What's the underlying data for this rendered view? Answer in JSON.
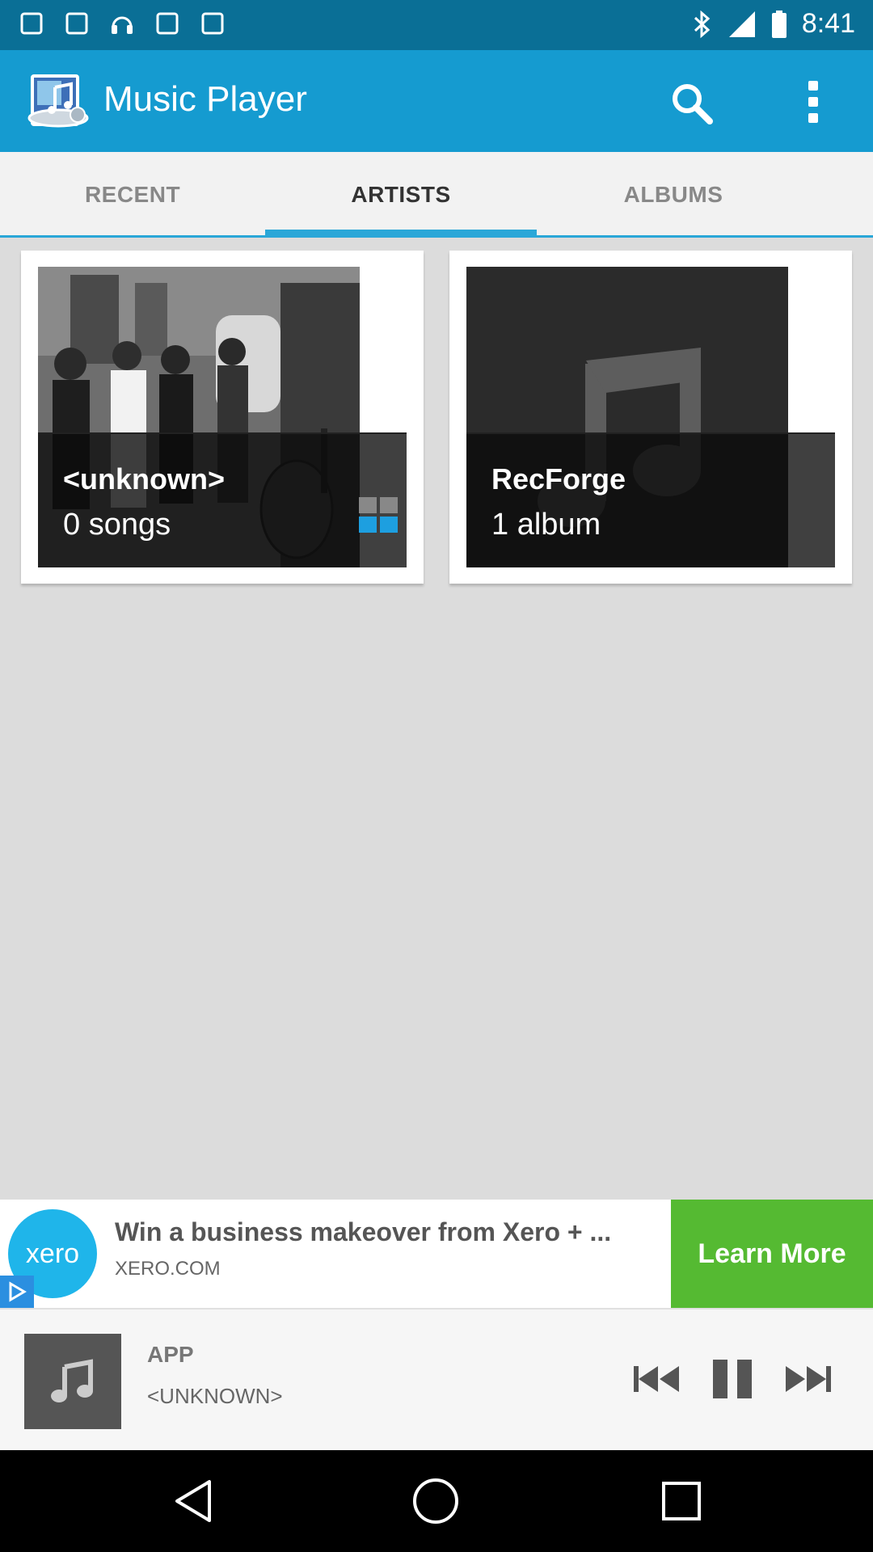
{
  "status_bar": {
    "time": "8:41"
  },
  "app_bar": {
    "title": "Music Player",
    "icons": [
      "app-logo-icon",
      "search-icon",
      "more-vert-icon"
    ]
  },
  "tabs": [
    {
      "label": "RECENT",
      "active": false
    },
    {
      "label": "ARTISTS",
      "active": true
    },
    {
      "label": "ALBUMS",
      "active": false
    }
  ],
  "artists": [
    {
      "name": "<unknown>",
      "subtitle": "0 songs"
    },
    {
      "name": "RecForge",
      "subtitle": "1 album"
    }
  ],
  "ad": {
    "logo_text": "xero",
    "title": "Win a business makeover from Xero + ...",
    "domain": "XERO.COM",
    "cta": "Learn More"
  },
  "now_playing": {
    "title": "APP",
    "artist": "<UNKNOWN>",
    "controls": [
      "rewind-icon",
      "pause-icon",
      "fast-forward-icon"
    ]
  },
  "colors": {
    "app_bar": "#159bd0",
    "status_bar": "#0a6f96",
    "accent": "#2aa7d8",
    "ad_cta": "#55ba32",
    "background": "#dcdcdc"
  }
}
